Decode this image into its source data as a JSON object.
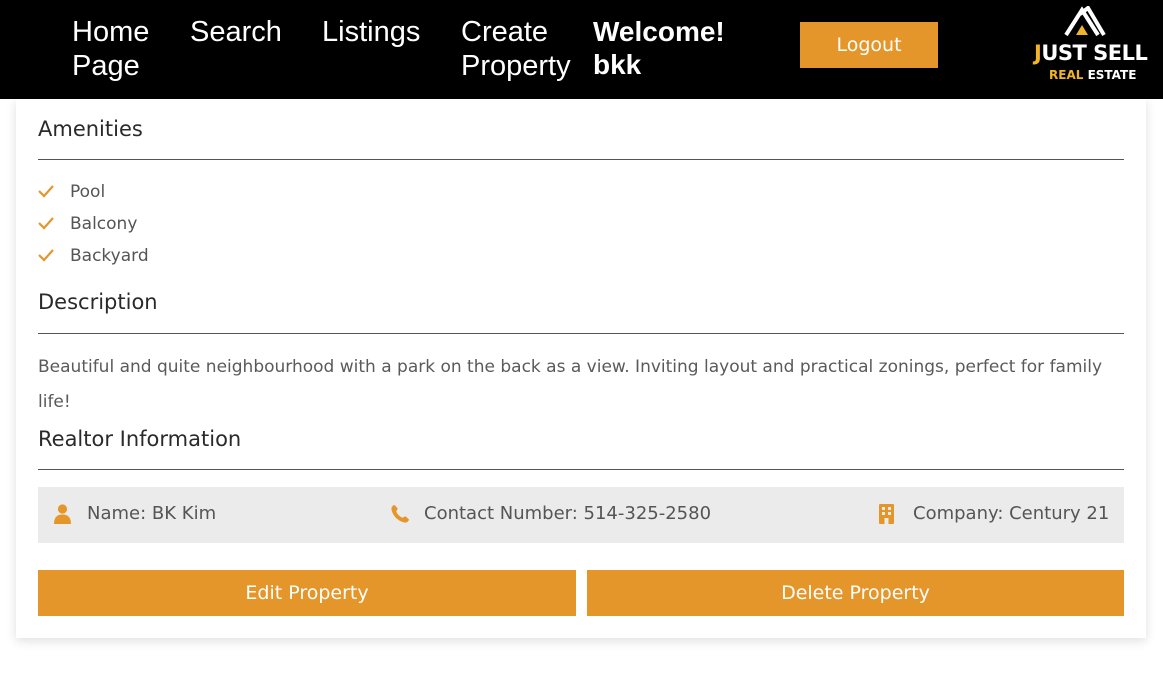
{
  "nav": {
    "home": "Home Page",
    "search": "Search",
    "listings": "Listings",
    "create": "Create Property",
    "welcome": "Welcome! bkk",
    "logout": "Logout"
  },
  "logo": {
    "main_accent": "J",
    "main_rest": "UST SELL",
    "sub_accent": "REAL",
    "sub_rest": "ESTATE"
  },
  "amenities": {
    "title": "Amenities",
    "items": [
      "Pool",
      "Balcony",
      "Backyard"
    ],
    "icon": "check-icon"
  },
  "description": {
    "title": "Description",
    "text": "Beautiful and quite neighbourhood with a park on the back as a view. Inviting layout and practical zonings, perfect for family life!"
  },
  "realtor": {
    "title": "Realtor Information",
    "name": "Name: BK Kim",
    "contact": "Contact Number: 514-325-2580",
    "company": "Company: Century 21",
    "icons": [
      "user-icon",
      "phone-icon",
      "building-icon"
    ]
  },
  "actions": {
    "edit": "Edit Property",
    "delete": "Delete Property"
  },
  "colors": {
    "accent": "#e5962a",
    "navbar": "#000000",
    "logo_accent": "#f0b429",
    "info_bg": "#ebebeb"
  }
}
